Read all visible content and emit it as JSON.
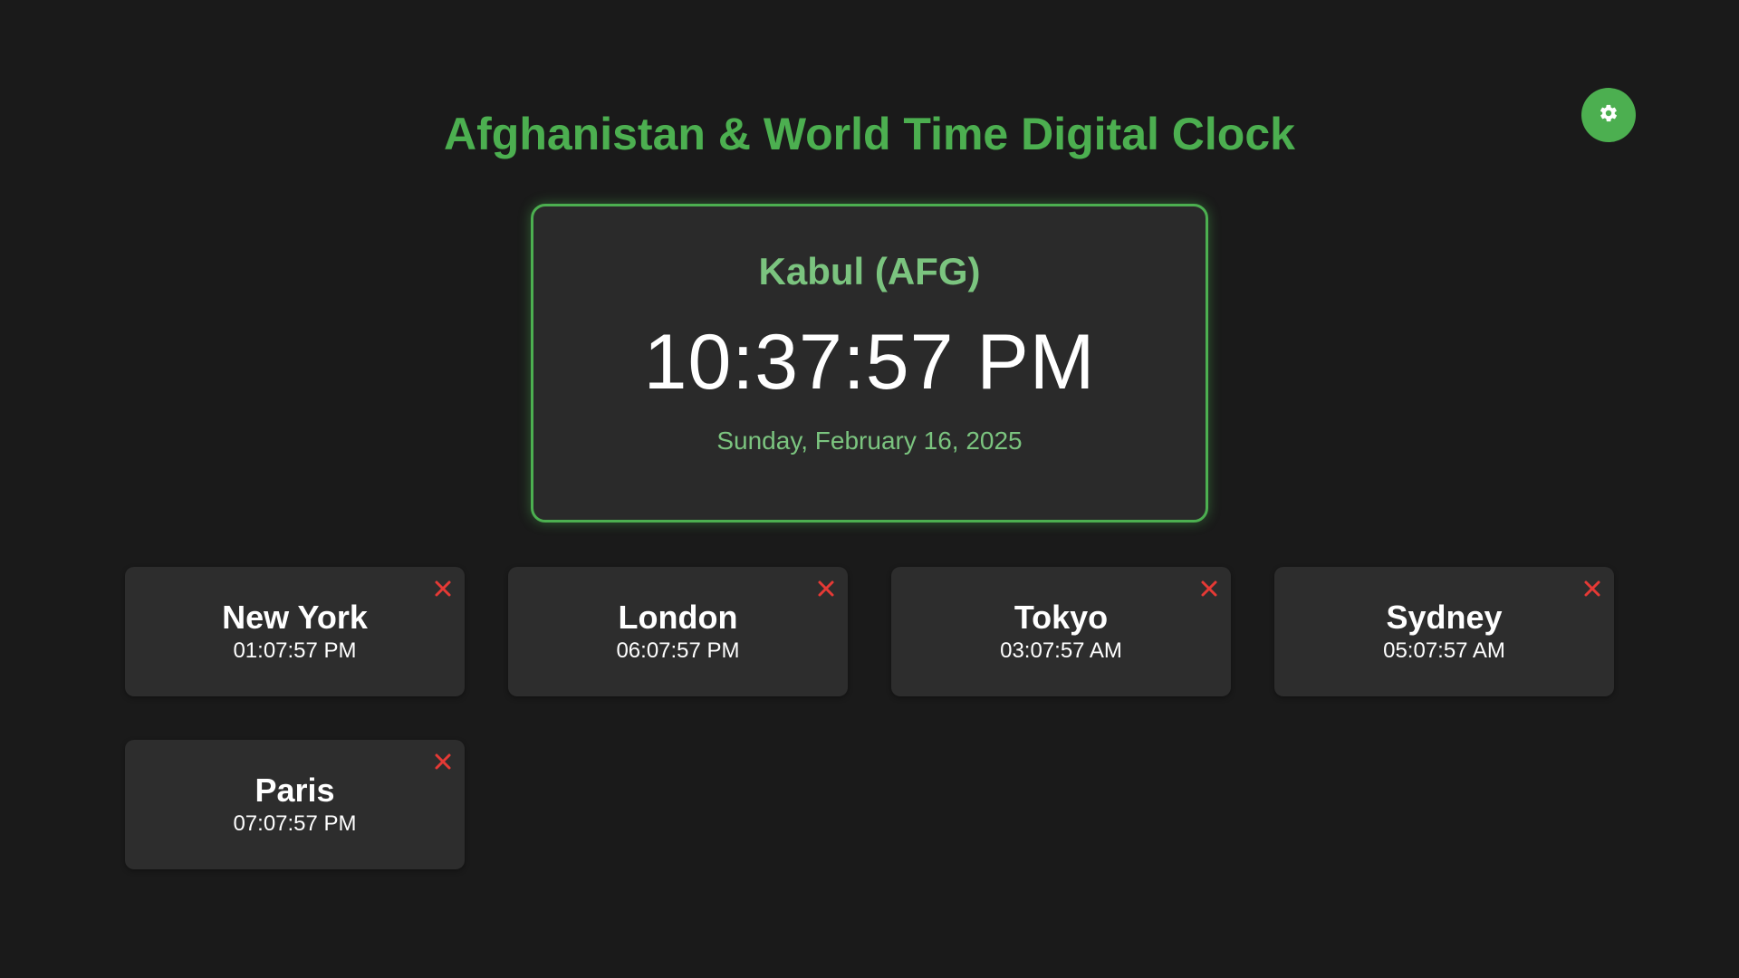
{
  "header": {
    "title": "Afghanistan & World Time Digital Clock"
  },
  "settings": {
    "icon": "gear-icon",
    "color": "#4caf50"
  },
  "main_clock": {
    "city": "Kabul (AFG)",
    "time": "10:37:57 PM",
    "date": "Sunday, February 16, 2025"
  },
  "world_clocks": [
    {
      "city": "New York",
      "time": "01:07:57 PM"
    },
    {
      "city": "London",
      "time": "06:07:57 PM"
    },
    {
      "city": "Tokyo",
      "time": "03:07:57 AM"
    },
    {
      "city": "Sydney",
      "time": "05:07:57 AM"
    },
    {
      "city": "Paris",
      "time": "07:07:57 PM"
    }
  ],
  "colors": {
    "background": "#1a1a1a",
    "accent": "#4caf50",
    "accent_light": "#7bc47f",
    "card": "#2d2d2d",
    "remove": "#e53935"
  }
}
